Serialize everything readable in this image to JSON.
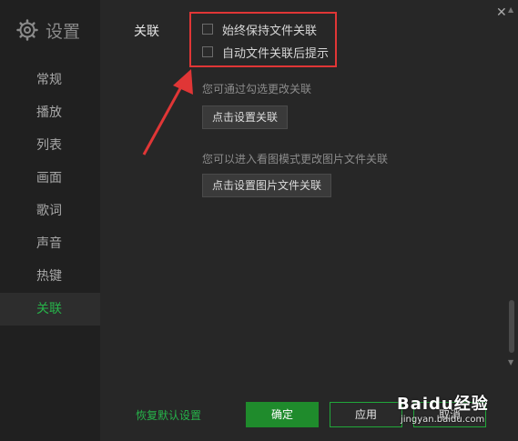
{
  "sidebar": {
    "title": "设置",
    "items": [
      {
        "label": "常规"
      },
      {
        "label": "播放"
      },
      {
        "label": "列表"
      },
      {
        "label": "画面"
      },
      {
        "label": "歌词"
      },
      {
        "label": "声音"
      },
      {
        "label": "热键"
      },
      {
        "label": "关联",
        "active": true
      }
    ]
  },
  "main": {
    "section_label": "关联",
    "checkboxes": [
      {
        "label": "始终保持文件关联",
        "checked": false
      },
      {
        "label": "自动文件关联后提示",
        "checked": false
      }
    ],
    "hint1": "您可通过勾选更改关联",
    "button1": "点击设置关联",
    "hint2": "您可以进入看图模式更改图片文件关联",
    "button2": "点击设置图片文件关联"
  },
  "footer": {
    "reset": "恢复默认设置",
    "ok": "确定",
    "apply": "应用",
    "cancel": "取消"
  },
  "watermark": {
    "brand": "Baidu经验",
    "url": "jingyan.baidu.com"
  },
  "colors": {
    "accent": "#27b34a",
    "highlight": "#e03636",
    "background": "#272727",
    "sidebar": "#202020"
  },
  "icons": {
    "settings": "gear-icon",
    "close": "close-icon",
    "annotation": "red-arrow-icon"
  }
}
